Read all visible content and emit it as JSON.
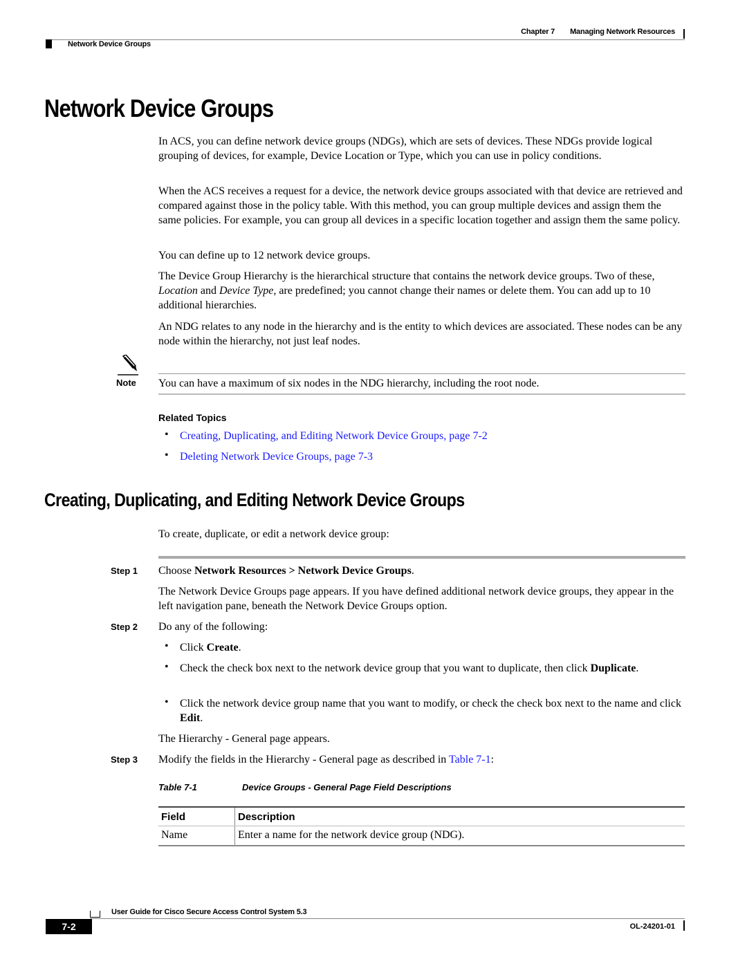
{
  "header": {
    "chapter": "Chapter 7",
    "chapter_title": "Managing Network Resources",
    "section": "Network Device Groups"
  },
  "title": "Network Device Groups",
  "intro_paragraphs": [
    "In ACS, you can define network device groups (NDGs), which are sets of devices. These NDGs provide logical grouping of devices, for example, Device Location or Type, which you can use in policy conditions.",
    "When the ACS receives a request for a device, the network device groups associated with that device are retrieved and compared against those in the policy table. With this method, you can group multiple devices and assign them the same policies. For example, you can group all devices in a specific location together and assign them the same policy.",
    "You can define up to 12 network device groups."
  ],
  "hierarchy_paragraph": {
    "part1": "The Device Group Hierarchy is the hierarchical structure that contains the network device groups. Two of these, ",
    "em1": "Location",
    "part2": " and ",
    "em2": "Device Type",
    "part3": ", are predefined; you cannot change their names or delete them. You can add up to 10 additional hierarchies."
  },
  "ndg_paragraph": "An NDG relates to any node in the hierarchy and is the entity to which devices are associated. These nodes can be any node within the hierarchy, not just leaf nodes.",
  "note": {
    "label": "Note",
    "text": "You can have a maximum of six nodes in the NDG hierarchy, including the root node."
  },
  "related_topics": {
    "heading": "Related Topics",
    "links": [
      "Creating, Duplicating, and Editing Network Device Groups, page 7-2",
      "Deleting Network Device Groups, page 7-3"
    ]
  },
  "section2": {
    "title": "Creating, Duplicating, and Editing Network Device Groups",
    "intro": "To create, duplicate, or edit a network device group:",
    "steps": {
      "step1": {
        "label": "Step 1",
        "pre": "Choose ",
        "bold": "Network Resources > Network Device Groups",
        "post": ".",
        "detail": "The Network Device Groups page appears. If you have defined additional network device groups, they appear in the left navigation pane, beneath the Network Device Groups option."
      },
      "step2": {
        "label": "Step 2",
        "text": "Do any of the following:",
        "bullets": [
          {
            "pre": "Click ",
            "bold": "Create",
            "post": "."
          },
          {
            "pre": "Check the check box next to the network device group that you want to duplicate, then click ",
            "bold": "Duplicate",
            "post": "."
          },
          {
            "pre": "Click the network device group name that you want to modify, or check the check box next to the name and click ",
            "bold": "Edit",
            "post": "."
          }
        ],
        "result": "The Hierarchy - General page appears."
      },
      "step3": {
        "label": "Step 3",
        "pre": "Modify the fields in the Hierarchy - General page as described in ",
        "link": "Table 7-1",
        "post": ":"
      }
    }
  },
  "table": {
    "caption_label": "Table 7-1",
    "caption_title": "Device Groups - General Page Field Descriptions",
    "headers": [
      "Field",
      "Description"
    ],
    "rows": [
      [
        "Name",
        "Enter a name for the network device group (NDG)."
      ]
    ]
  },
  "footer": {
    "guide_title": "User Guide for Cisco Secure Access Control System 5.3",
    "page_number": "7-2",
    "doc_number": "OL-24201-01"
  }
}
